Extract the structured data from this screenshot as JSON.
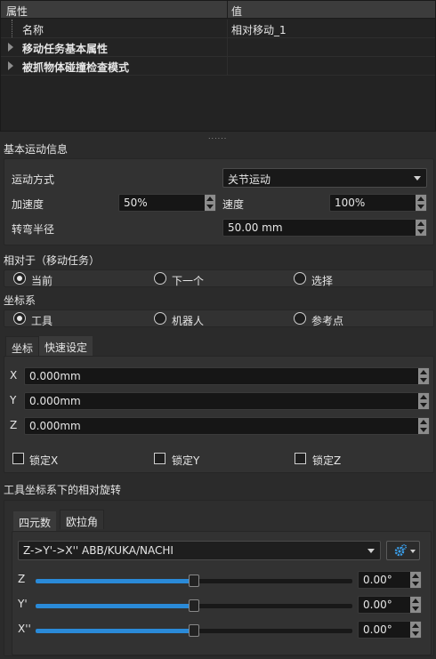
{
  "property_tree": {
    "col_name": "属性",
    "col_value": "值",
    "rows": [
      {
        "name": "名称",
        "value": "相对移动_1"
      },
      {
        "name": "移动任务基本属性",
        "value": ""
      },
      {
        "name": "被抓物体碰撞检查模式",
        "value": ""
      }
    ]
  },
  "splitter": "......",
  "basic_motion": {
    "title": "基本运动信息",
    "motion_type_label": "运动方式",
    "motion_type_value": "关节运动",
    "accel_label": "加速度",
    "accel_value": "50%",
    "speed_label": "速度",
    "speed_value": "100%",
    "blend_label": "转弯半径",
    "blend_value": "50.00 mm"
  },
  "relative_to": {
    "title": "相对于（移动任务）",
    "options": [
      "当前",
      "下一个",
      "选择"
    ],
    "selected": 0
  },
  "coord_system": {
    "title": "坐标系",
    "options": [
      "工具",
      "机器人",
      "参考点"
    ],
    "selected": 0
  },
  "coord_tabs": [
    "坐标",
    "快速设定"
  ],
  "coords": [
    {
      "axis": "X",
      "value": "0.000mm"
    },
    {
      "axis": "Y",
      "value": "0.000mm"
    },
    {
      "axis": "Z",
      "value": "0.000mm"
    }
  ],
  "locks": [
    "锁定X",
    "锁定Y",
    "锁定Z"
  ],
  "rotation": {
    "title": "工具坐标系下的相对旋转",
    "tabs": [
      "四元数",
      "欧拉角"
    ],
    "convention": "Z->Y'->X'' ABB/KUKA/NACHI",
    "gear_icon": "gear-icon",
    "axes": [
      {
        "label": "Z",
        "value": "0.00°",
        "level": 0.5
      },
      {
        "label": "Y'",
        "value": "0.00°",
        "level": 0.5
      },
      {
        "label": "X''",
        "value": "0.00°",
        "level": 0.5
      }
    ]
  },
  "colors": {
    "accent": "#2a8ad8",
    "background": "#2b2b2b"
  }
}
